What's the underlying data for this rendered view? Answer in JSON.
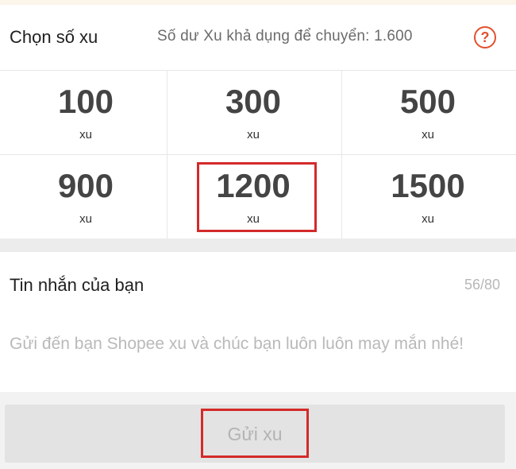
{
  "header": {
    "title": "Chọn số xu",
    "balance_text": "Số dư Xu khả dụng để chuyển: 1.600",
    "help_icon": "help-circle-icon",
    "help_glyph": "?"
  },
  "options": [
    {
      "amount": "100",
      "unit": "xu"
    },
    {
      "amount": "300",
      "unit": "xu"
    },
    {
      "amount": "500",
      "unit": "xu"
    },
    {
      "amount": "900",
      "unit": "xu"
    },
    {
      "amount": "1200",
      "unit": "xu",
      "selected": true
    },
    {
      "amount": "1500",
      "unit": "xu"
    }
  ],
  "message": {
    "title": "Tin nhắn của bạn",
    "count": "56/80",
    "text": "Gửi đến bạn Shopee xu và chúc bạn luôn luôn may mắn nhé!"
  },
  "footer": {
    "send_label": "Gửi xu"
  },
  "colors": {
    "accent_red": "#d42a2a",
    "help_orange": "#e2502f",
    "amount_text": "#444444",
    "placeholder_text": "#b9b9b9",
    "button_disabled_bg": "#e3e3e3"
  }
}
